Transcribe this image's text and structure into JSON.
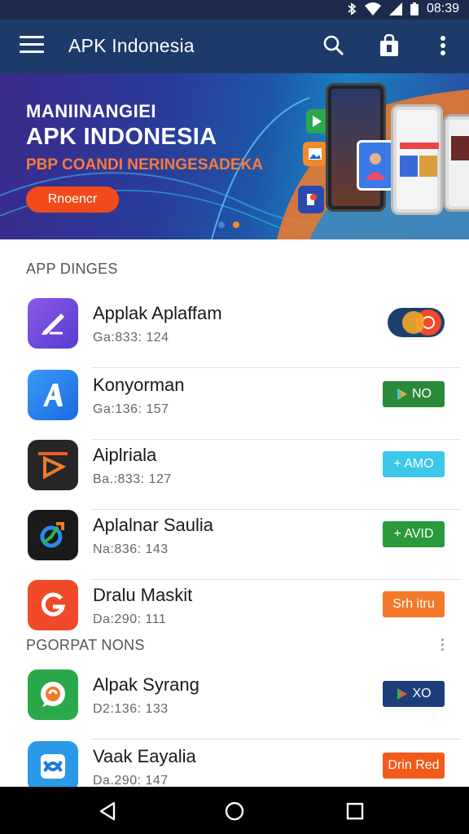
{
  "status_bar": {
    "time": "08:39",
    "icons": [
      "bluetooth-icon",
      "wifi-icon",
      "signal-icon",
      "battery-icon"
    ]
  },
  "app_bar": {
    "title": "APK Indonesia",
    "menu_icon": "hamburger-icon",
    "search_icon": "search-icon",
    "bag_icon": "shopping-bag-icon",
    "more_icon": "more-vert-icon"
  },
  "banner": {
    "line1": "MANIINANGIEI",
    "line2": "APK INDONESIA",
    "line3": "PBP COANDI NERINGESADEKA",
    "button_label": "Rnoencr",
    "pages": 2,
    "active_page": 1
  },
  "sections": [
    {
      "title": "APP DINGES",
      "apps": [
        {
          "name": "Applak Aplaffam",
          "meta": "Ga:833: 124",
          "icon": "pen-app-icon",
          "icon_color": "#7a4fd8",
          "action": {
            "kind": "toggle",
            "label": ""
          }
        },
        {
          "name": "Konyorman",
          "meta": "Ga:136: 157",
          "icon": "letter-a-app-icon",
          "icon_color": "#2a7ff0",
          "action": {
            "kind": "button",
            "label": "NO",
            "color": "#2a8a3a",
            "glyph": "play-icon"
          }
        },
        {
          "name": "Aiplriala",
          "meta": "Ba.:833: 127",
          "icon": "play-triangle-app-icon",
          "icon_color": "#2a2a2a",
          "action": {
            "kind": "button",
            "label": "+ AMO",
            "color": "#3cc8e8",
            "glyph": ""
          }
        },
        {
          "name": "Aplalnar Saulia",
          "meta": "Na:836: 143",
          "icon": "swirl-app-icon",
          "icon_color": "#1a1a1a",
          "action": {
            "kind": "button",
            "label": "+ AVID",
            "color": "#2a9a3a",
            "glyph": ""
          }
        },
        {
          "name": "Dralu Maskit",
          "meta": "Da:290: 111",
          "icon": "letter-g-app-icon",
          "icon_color": "#f04a2a",
          "action": {
            "kind": "button",
            "label": "Srh itru",
            "color": "#f27a2a",
            "glyph": ""
          }
        }
      ]
    },
    {
      "title": "PGORPAT NONS",
      "apps": [
        {
          "name": "Alpak Syrang",
          "meta": "D2:136: 133",
          "icon": "chat-bubble-app-icon",
          "icon_color": "#2aa84a",
          "action": {
            "kind": "button",
            "label": "XO",
            "color": "#1d3e7a",
            "glyph": "play-icon"
          }
        },
        {
          "name": "Vaak Eayalia",
          "meta": "Da.290: 147",
          "icon": "infinity-app-icon",
          "icon_color": "#2a9ae8",
          "action": {
            "kind": "button",
            "label": "Drin Red",
            "color": "#f25a1a",
            "glyph": ""
          }
        }
      ]
    }
  ],
  "nav_bar": {
    "back_icon": "back-icon",
    "home_icon": "home-icon",
    "recents_icon": "recents-icon"
  }
}
